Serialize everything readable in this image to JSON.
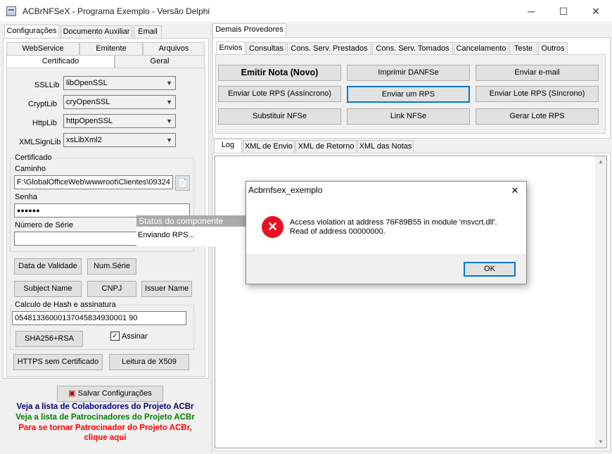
{
  "window": {
    "title": "ACBrNFSeX - Programa Exemplo - Versão Delphi",
    "minimize": "─",
    "maximize": "☐",
    "close": "✕"
  },
  "left": {
    "tabs": [
      "Configurações",
      "Documento Auxiliar",
      "Email"
    ],
    "subtabs_row1": [
      "WebService",
      "Emitente",
      "Arquivos"
    ],
    "subtabs_row2": [
      "Certificado",
      "Geral"
    ],
    "libs": [
      {
        "label": "SSLLib",
        "value": "libOpenSSL"
      },
      {
        "label": "CryptLib",
        "value": "cryOpenSSL"
      },
      {
        "label": "HttpLib",
        "value": "httpOpenSSL"
      },
      {
        "label": "XMLSignLib",
        "value": "xsLibXml2"
      }
    ],
    "cert_group": "Certificado",
    "caminho_label": "Caminho",
    "caminho_value": "F:\\GlobalOfficeWeb\\wwwroot\\Clientes\\09324",
    "senha_label": "Senha",
    "senha_value": "●●●●●●",
    "serie_label": "Número de Série",
    "serie_value": "",
    "btn_validade": "Data de Validade",
    "btn_numserie": "Num.Série",
    "btn_subject": "Subject Name",
    "btn_cnpj": "CNPJ",
    "btn_issuer": "Issuer Name",
    "hash_group": "Calculo de Hash e assinatura",
    "hash_value": "05481336000137045834930001 90",
    "btn_sha": "SHA256+RSA",
    "assinar_label": "Assinar",
    "assinar_checked": "✓",
    "btn_https": "HTTPS sem Certificado",
    "btn_x509": "Leitura de X509",
    "btn_salvar": "Salvar Configurações",
    "links": [
      {
        "text": "Veja a lista de Colaboradores do Projeto ACBr",
        "color": "#000080"
      },
      {
        "text": "Veja a lista de Patrocinadores do Projeto ACBr",
        "color": "#008000"
      },
      {
        "text": "Para se tornar Patrocinador do Projeto ACBr,",
        "color": "#ff0000"
      },
      {
        "text": "clique aqui",
        "color": "#ff0000"
      }
    ]
  },
  "status": {
    "title": "Status do componente",
    "message": "Enviando RPS..."
  },
  "right": {
    "top_tab": "Demais Provedores",
    "tabs": [
      "Envios",
      "Consultas",
      "Cons. Serv. Prestados",
      "Cons. Serv. Tomados",
      "Cancelamento",
      "Teste",
      "Outros"
    ],
    "buttons": [
      "Emitir Nota (Novo)",
      "Imprimir DANFSe",
      "Enviar e-mail",
      "Enviar Lote RPS (Assíncrono)",
      "Enviar um RPS",
      "Enviar Lote RPS (Síncrono)",
      "Substituir NFSe",
      "Link NFSe",
      "Gerar Lote RPS"
    ],
    "log_tabs": [
      "Log",
      "XML de Envio",
      "XML de Retorno",
      "XML das Notas"
    ]
  },
  "dialog": {
    "title": "Acbrnfsex_exemplo",
    "close": "✕",
    "message_line1": "Access violation at address 76F89B55 in module 'msvcrt.dll'.",
    "message_line2": "Read of address 00000000.",
    "ok": "OK"
  }
}
